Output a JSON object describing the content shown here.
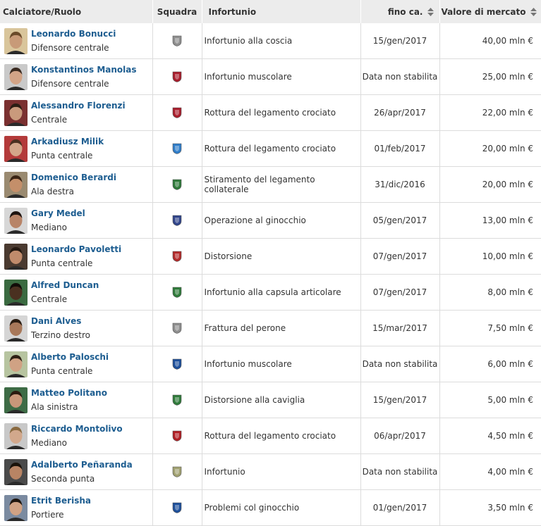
{
  "headers": {
    "player": "Calciatore/Ruolo",
    "team": "Squadra",
    "injury": "Infortunio",
    "until": "fino ca.",
    "value": "Valore di mercato"
  },
  "rows": [
    {
      "name": "Leonardo Bonucci",
      "role": "Difensore centrale",
      "injury": "Infortunio alla coscia",
      "until": "15/gen/2017",
      "value": "40,00 mln €",
      "crest": "juventus-crest",
      "crest_color": "#8d8d8d",
      "skin": "#c89a78",
      "hair": "#6a4a2a",
      "bg": "#d9c59b"
    },
    {
      "name": "Konstantinos Manolas",
      "role": "Difensore centrale",
      "injury": "Infortunio muscolare",
      "until": "Data non stabilita",
      "value": "25,00 mln €",
      "crest": "roma-crest",
      "crest_color": "#a81d2c",
      "skin": "#d2a487",
      "hair": "#3a2a20",
      "bg": "#c9c9c9"
    },
    {
      "name": "Alessandro Florenzi",
      "role": "Centrale",
      "injury": "Rottura del legamento crociato",
      "until": "26/apr/2017",
      "value": "22,00 mln €",
      "crest": "roma-crest",
      "crest_color": "#a81d2c",
      "skin": "#c99a7c",
      "hair": "#2c1e14",
      "bg": "#7a3030"
    },
    {
      "name": "Arkadiusz Milik",
      "role": "Punta centrale",
      "injury": "Rottura del legamento crociato",
      "until": "01/feb/2017",
      "value": "20,00 mln €",
      "crest": "napoli-crest",
      "crest_color": "#2f7dc9",
      "skin": "#d3a68a",
      "hair": "#4a3020",
      "bg": "#b33a3a"
    },
    {
      "name": "Domenico Berardi",
      "role": "Ala destra",
      "injury": "Stiramento del legamento collaterale",
      "until": "31/dic/2016",
      "value": "20,00 mln €",
      "crest": "sassuolo-crest",
      "crest_color": "#2f7a3a",
      "skin": "#c48f6a",
      "hair": "#3a2414",
      "bg": "#9a8a70"
    },
    {
      "name": "Gary Medel",
      "role": "Mediano",
      "injury": "Operazione al ginocchio",
      "until": "05/gen/2017",
      "value": "13,00 mln €",
      "crest": "inter-crest",
      "crest_color": "#30448a",
      "skin": "#b88468",
      "hair": "#1e1410",
      "bg": "#d7d7d7"
    },
    {
      "name": "Leonardo Pavoletti",
      "role": "Punta centrale",
      "injury": "Distorsione",
      "until": "07/gen/2017",
      "value": "10,00 mln €",
      "crest": "genoa-crest",
      "crest_color": "#b22a2a",
      "skin": "#c08b6c",
      "hair": "#241810",
      "bg": "#4a3a30"
    },
    {
      "name": "Alfred Duncan",
      "role": "Centrale",
      "injury": "Infortunio alla capsula articolare",
      "until": "07/gen/2017",
      "value": "8,00 mln €",
      "crest": "sassuolo-crest",
      "crest_color": "#2f7a3a",
      "skin": "#4a3020",
      "hair": "#120c08",
      "bg": "#3a6a40"
    },
    {
      "name": "Dani Alves",
      "role": "Terzino destro",
      "injury": "Frattura del perone",
      "until": "15/mar/2017",
      "value": "7,50 mln €",
      "crest": "juventus-crest",
      "crest_color": "#8d8d8d",
      "skin": "#a8785a",
      "hair": "#2a1c12",
      "bg": "#d5d5d5"
    },
    {
      "name": "Alberto Paloschi",
      "role": "Punta centrale",
      "injury": "Infortunio muscolare",
      "until": "Data non stabilita",
      "value": "6,00 mln €",
      "crest": "atalanta-crest",
      "crest_color": "#1d4f9a",
      "skin": "#d0a284",
      "hair": "#2e2014",
      "bg": "#b7c4a0"
    },
    {
      "name": "Matteo Politano",
      "role": "Ala sinistra",
      "injury": "Distorsione alla caviglia",
      "until": "15/gen/2017",
      "value": "5,00 mln €",
      "crest": "sassuolo-crest",
      "crest_color": "#2f7a3a",
      "skin": "#c8977a",
      "hair": "#2a1a10",
      "bg": "#3d6b45"
    },
    {
      "name": "Riccardo Montolivo",
      "role": "Mediano",
      "injury": "Rottura del legamento crociato",
      "until": "06/apr/2017",
      "value": "4,50 mln €",
      "crest": "milan-crest",
      "crest_color": "#b01e24",
      "skin": "#d2a88c",
      "hair": "#8a6a40",
      "bg": "#c8c8c8"
    },
    {
      "name": "Adalberto Peñaranda",
      "role": "Seconda punta",
      "injury": "Infortunio",
      "until": "Data non stabilita",
      "value": "4,00 mln €",
      "crest": "udinese-crest",
      "crest_color": "#a0a070",
      "skin": "#b88464",
      "hair": "#1a120a",
      "bg": "#4a4a4a"
    },
    {
      "name": "Etrit Berisha",
      "role": "Portiere",
      "injury": "Problemi col ginocchio",
      "until": "01/gen/2017",
      "value": "3,50 mln €",
      "crest": "atalanta-crest",
      "crest_color": "#1d4f9a",
      "skin": "#d0a284",
      "hair": "#20160e",
      "bg": "#7a8aa0"
    }
  ]
}
